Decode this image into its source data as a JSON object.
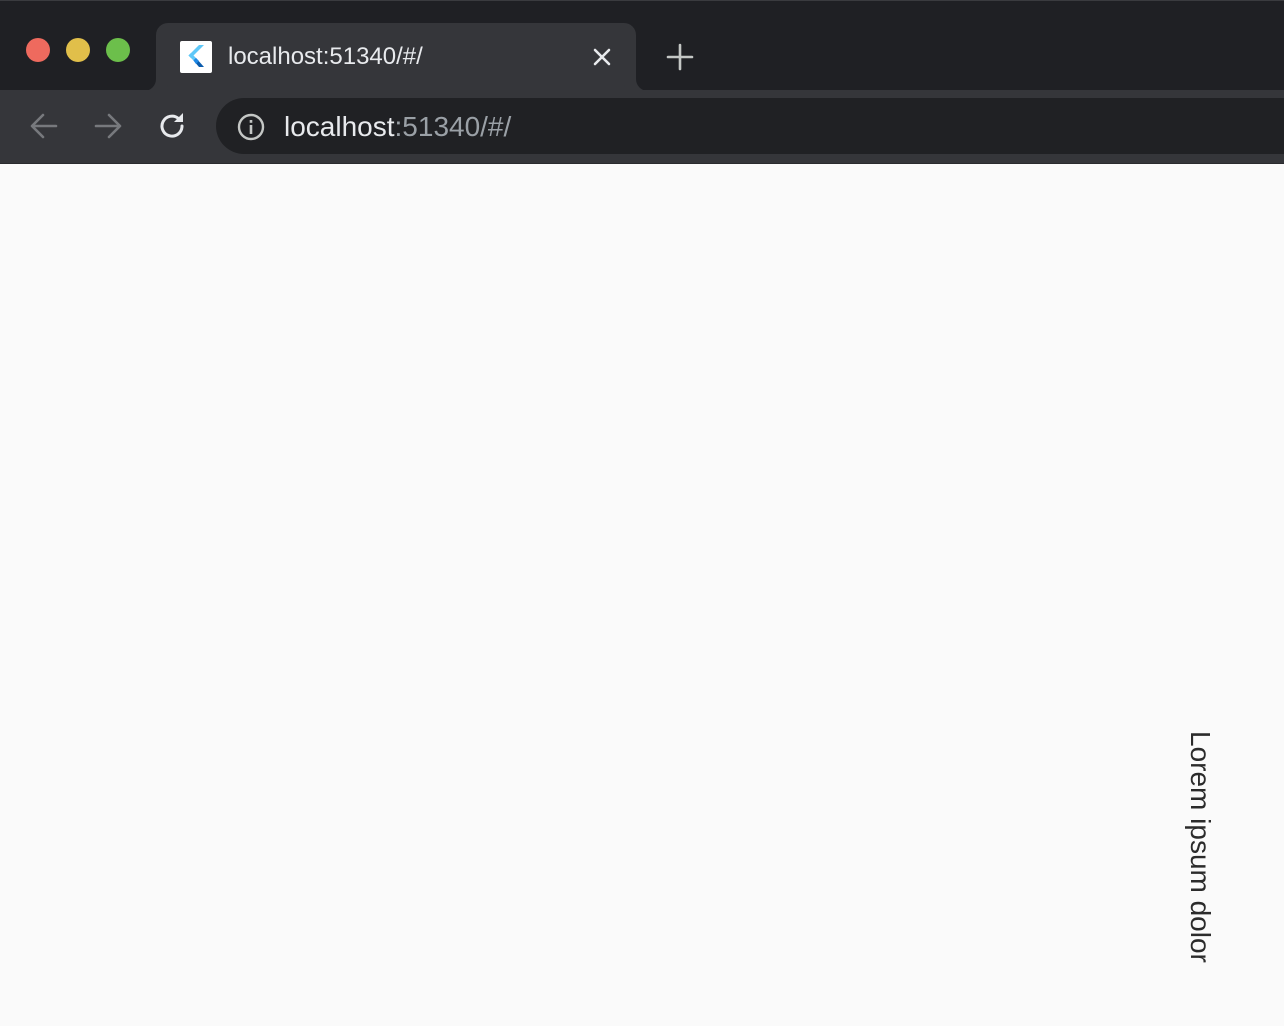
{
  "tab": {
    "title": "localhost:51340/#/",
    "favicon_icon": "flutter-logo-icon"
  },
  "address_bar": {
    "host": "localhost",
    "rest": ":51340/#/"
  },
  "page": {
    "vertical_text": "Lorem ipsum dolor"
  },
  "colors": {
    "titlebar": "#1f2024",
    "tab_active": "#35363a",
    "omnibox": "#202124",
    "page_background": "#fafafa",
    "traffic_red": "#ee6a5e",
    "traffic_yellow": "#e1bf4a",
    "traffic_green": "#6cbf4b"
  }
}
